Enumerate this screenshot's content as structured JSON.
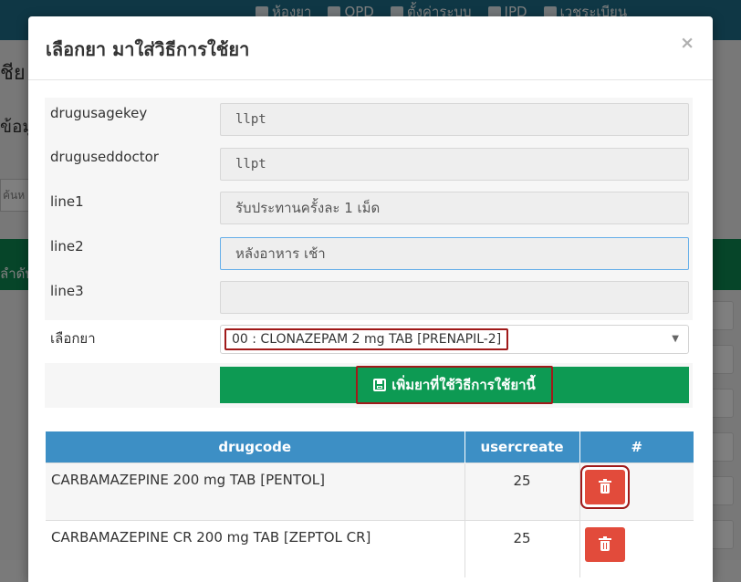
{
  "background": {
    "nav_items": [
      {
        "label": "ห้องยา",
        "icon": "building-icon"
      },
      {
        "label": "OPD",
        "icon": "users-icon"
      },
      {
        "label": "ตั้งค่าระบบ",
        "icon": "gears-icon"
      },
      {
        "label": "IPD",
        "icon": "bed-icon"
      },
      {
        "label": "เวชระเบียน",
        "icon": "table-icon"
      }
    ],
    "page_title_fragment": "ชีย",
    "section_fragment": "ข้อมู",
    "search_placeholder_fragment": "ค้นห",
    "table_header_fragment": "ลำดับ"
  },
  "modal": {
    "title": "เลือกยา มาใส่วิธีการใช้ยา",
    "close_label": "×"
  },
  "form": {
    "fields": [
      {
        "label": "drugusagekey",
        "value": "llpt"
      },
      {
        "label": "druguseddoctor",
        "value": "llpt"
      },
      {
        "label": "line1",
        "value": "รับประทานครั้งละ 1 เม็ด"
      },
      {
        "label": "line2",
        "value": "หลังอาหาร เช้า"
      },
      {
        "label": "line3",
        "value": ""
      }
    ],
    "drug_select": {
      "label": "เลือกยา",
      "selected": "00 : CLONAZEPAM 2 mg TAB [PRENAPIL-2]"
    },
    "add_button_label": "เพิ่มยาที่ใช้วิธีการใช้ยานี้"
  },
  "table": {
    "headers": [
      "drugcode",
      "usercreate",
      "#"
    ],
    "rows": [
      {
        "drugcode": "CARBAMAZEPINE 200 mg TAB [PENTOL]",
        "usercreate": "25"
      },
      {
        "drugcode": "CARBAMAZEPINE CR 200 mg TAB [ZEPTOL CR]",
        "usercreate": "25"
      }
    ]
  },
  "colors": {
    "nav": "#1f6f8b",
    "primary_green": "#0d9a53",
    "table_header": "#3d8fc5",
    "danger": "#e24b3b",
    "highlight_border": "#a01a1a"
  }
}
